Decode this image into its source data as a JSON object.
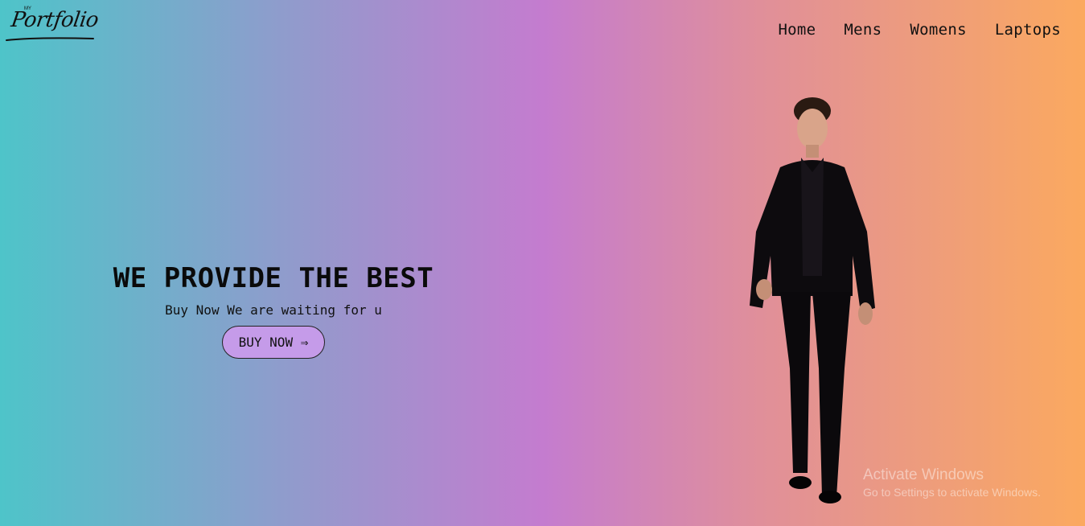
{
  "brand": {
    "logo_small": "MY",
    "logo_text": "Portfolio"
  },
  "nav": {
    "items": [
      {
        "label": "Home"
      },
      {
        "label": "Mens"
      },
      {
        "label": "Womens"
      },
      {
        "label": "Laptops"
      }
    ]
  },
  "hero": {
    "title": "WE PROVIDE THE BEST",
    "subtitle": "Buy Now We are waiting for u",
    "button_label": "BUY NOW ⇒"
  },
  "watermark": {
    "title": "Activate Windows",
    "subtitle": "Go to Settings to activate Windows."
  },
  "colors": {
    "gradient_start": "#4ec4c9",
    "gradient_mid": "#c47ccf",
    "gradient_end": "#fba95f",
    "button_bg": "#c59be9"
  }
}
